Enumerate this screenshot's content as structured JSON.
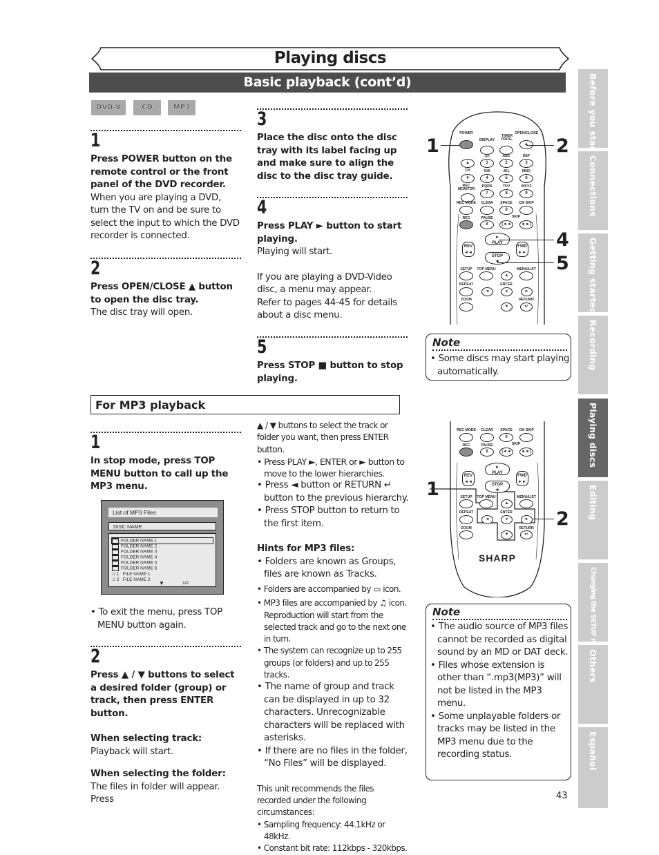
{
  "page": {
    "title": "Playing discs",
    "section": "Basic playback (cont’d)",
    "page_number": "43"
  },
  "disc_badges": [
    "DVD-V",
    "CD",
    "MP3"
  ],
  "side_tabs": [
    {
      "label": "Before you start",
      "active": false
    },
    {
      "label": "Connections",
      "active": false
    },
    {
      "label": "Getting started",
      "active": false
    },
    {
      "label": "Recording",
      "active": false
    },
    {
      "label": "Playing discs",
      "active": true
    },
    {
      "label": "Editing",
      "active": false
    },
    {
      "label": "Changing the SETUP menu",
      "active": false
    },
    {
      "label": "Others",
      "active": false
    },
    {
      "label": "Español",
      "active": false
    }
  ],
  "basic_steps": {
    "step1": {
      "num": "1",
      "bold": "Press POWER button on the remote control or the front panel of the DVD recorder.",
      "text": "When you are playing a DVD, turn the TV on and be sure to select the input to which the DVD recorder is connected."
    },
    "step2": {
      "num": "2",
      "bold": "Press OPEN/CLOSE ▲ button to open the disc tray.",
      "text": "The disc tray will open."
    },
    "step3": {
      "num": "3",
      "bold": "Place the disc onto the disc tray with its label facing up and make sure to align the disc to the disc tray guide."
    },
    "step4": {
      "num": "4",
      "bold": "Press PLAY ► button to start playing.",
      "text1": "Playing will start.",
      "text2": "If you are playing a DVD-Video disc, a menu may appear.",
      "text3": "Refer to pages 44-45 for details about a disc menu."
    },
    "step5": {
      "num": "5",
      "bold": "Press STOP ■ button to stop playing."
    }
  },
  "note1": {
    "title": "Note",
    "items": [
      "Some discs may start playing automatically."
    ]
  },
  "remote1": {
    "labels": {
      "power": "POWER",
      "display": "DISPLAY",
      "timer": "TIMER PROG.",
      "open_close": "OPEN/CLOSE",
      "ch": "CH",
      "rec_monitor": "REC MONITOR",
      "rec_mode": "REC MODE",
      "clear": "CLEAR",
      "space": "SPACE",
      "cm_skip": "CM SKIP",
      "rec": "REC",
      "pause": "PAUSE",
      "skip": "SKIP",
      "rev": "REV",
      "play": "PLAY",
      "fwd": "FWD",
      "stop": "STOP",
      "setup": "SETUP",
      "top_menu": "TOP MENU",
      "menu_list": "MENU/LIST",
      "repeat": "REPEAT",
      "enter": "ENTER",
      "zoom": "ZOOM",
      "return": "RETURN"
    },
    "keypad": [
      {
        "letters": ".@/:",
        "num": "1"
      },
      {
        "letters": "ABC",
        "num": "2"
      },
      {
        "letters": "DEF",
        "num": "3"
      },
      {
        "letters": "GHI",
        "num": "4"
      },
      {
        "letters": "JKL",
        "num": "5"
      },
      {
        "letters": "MNO",
        "num": "6"
      },
      {
        "letters": "PQRS",
        "num": "7"
      },
      {
        "letters": "TUV",
        "num": "8"
      },
      {
        "letters": "WXYZ",
        "num": "9"
      }
    ],
    "zero": "0",
    "callouts": [
      "1",
      "2",
      "4",
      "5"
    ]
  },
  "mp3": {
    "header": "For MP3 playback",
    "step1": {
      "num": "1",
      "bold": "In stop mode, press TOP MENU button to call up the MP3 menu.",
      "bullet": "To exit the menu, press TOP MENU button again."
    },
    "screen": {
      "title": "List of MP3 Files",
      "disc_name": "DISC NAME",
      "folders": [
        "FOLDER NAME 1",
        "FOLDER NAME 2",
        "FOLDER NAME 3",
        "FOLDER NAME 4",
        "FOLDER NAME 5",
        "FOLDER NAME 6"
      ],
      "files": [
        {
          "num": "1",
          "name": "FILE NAME 1"
        },
        {
          "num": "2",
          "name": "FILE NAME 2"
        }
      ],
      "page": "1/2"
    },
    "step2": {
      "num": "2",
      "bold": "Press ▲ / ▼ buttons to select a desired folder (group) or track, then press ENTER button.",
      "track_head": "When selecting track:",
      "track_text": "Playback will start.",
      "folder_head": "When selecting the folder:",
      "folder_text": "The files in folder will appear. Press"
    },
    "continued": {
      "lead": "▲ / ▼ buttons to select the track or folder you want, then press ENTER button.",
      "bullets": [
        "Press PLAY ►, ENTER or ► button to move to the lower hierarchies.",
        "Press ◄ button or RETURN ↵ button to the previous hierarchy.",
        "Press STOP button to return to the first item."
      ]
    },
    "hints": {
      "title": "Hints for MP3 files:",
      "items": [
        "Folders are known as Groups, files are known as Tracks.",
        "Folders are accompanied by ▭ icon.",
        "MP3 files are accompanied by ♫ icon. Reproduction will start from the selected track and go to the next one in turn.",
        "The system can recognize up to 255 groups (or folders) and up to 255 tracks.",
        "The name of group and track can be displayed in up to 32 characters. Unrecognizable characters will be replaced with asterisks.",
        "If there are no files in the folder, “No Files” will be displayed."
      ],
      "recommend": "This unit recommends the files recorded under the following circumstances:",
      "rec_items": [
        "Sampling frequency: 44.1kHz or 48kHz.",
        "Constant bit rate: 112kbps - 320kbps."
      ]
    },
    "remote_brand": "SHARP",
    "callouts": [
      "1",
      "2"
    ]
  },
  "note2": {
    "title": "Note",
    "items": [
      "The audio source of MP3 files cannot be recorded as digital sound by an MD or DAT deck.",
      "Files whose extension is other than “.mp3(MP3)” will not be listed in the MP3 menu.",
      "Some unplayable folders or tracks may be listed in the MP3 menu due to the recording status."
    ]
  }
}
